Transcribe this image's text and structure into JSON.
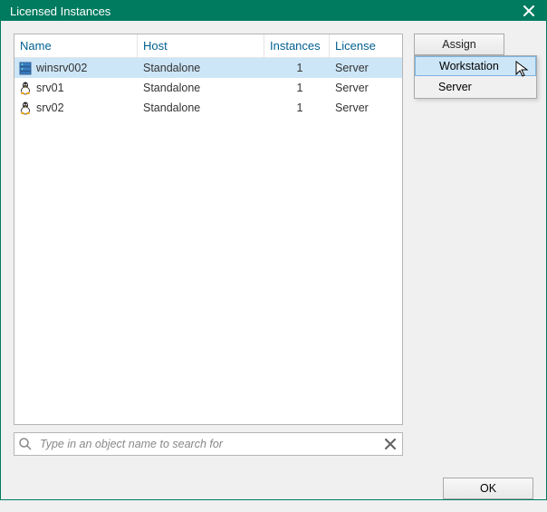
{
  "window": {
    "title": "Licensed Instances"
  },
  "grid": {
    "headers": {
      "name": "Name",
      "host": "Host",
      "instances": "Instances",
      "license": "License"
    },
    "rows": [
      {
        "name": "winsrv002",
        "host": "Standalone",
        "instances": "1",
        "license": "Server",
        "icon": "server-icon",
        "selected": true
      },
      {
        "name": "srv01",
        "host": "Standalone",
        "instances": "1",
        "license": "Server",
        "icon": "linux-icon",
        "selected": false
      },
      {
        "name": "srv02",
        "host": "Standalone",
        "instances": "1",
        "license": "Server",
        "icon": "linux-icon",
        "selected": false
      }
    ]
  },
  "buttons": {
    "assign": "Assign",
    "ok": "OK"
  },
  "dropdown": {
    "items": [
      {
        "label": "Workstation",
        "highlight": true
      },
      {
        "label": "Server",
        "highlight": false
      }
    ]
  },
  "search": {
    "placeholder": "Type in an object name to search for"
  }
}
